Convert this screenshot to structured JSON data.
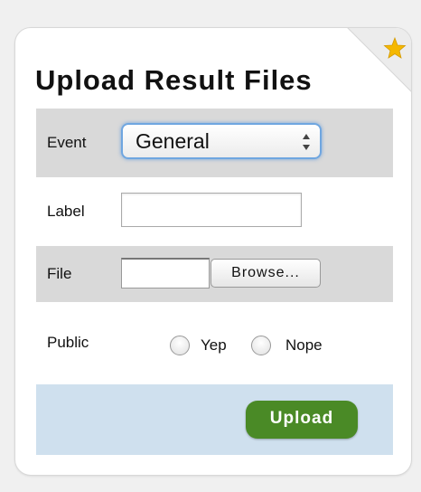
{
  "title": "Upload Result Files",
  "event": {
    "label": "Event",
    "selected": "General"
  },
  "label_field": {
    "label": "Label",
    "value": ""
  },
  "file_field": {
    "label": "File",
    "browse_label": "Browse..."
  },
  "public_field": {
    "label": "Public",
    "options": [
      "Yep",
      "Nope"
    ]
  },
  "upload_label": "Upload",
  "colors": {
    "upload_button": "#4a8a26",
    "star": "#f5b800",
    "form_footer": "#cfe0ee"
  },
  "icons": [
    "star-icon",
    "select-arrows-icon"
  ]
}
